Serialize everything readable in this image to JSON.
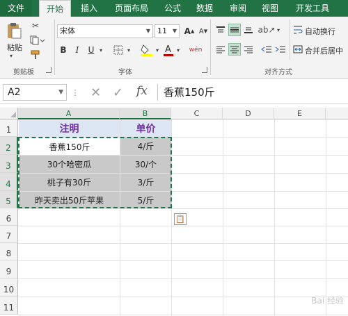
{
  "ribbon": {
    "tabs": [
      {
        "label": "文件",
        "name": "tab-file"
      },
      {
        "label": "开始",
        "name": "tab-home"
      },
      {
        "label": "插入",
        "name": "tab-insert"
      },
      {
        "label": "页面布局",
        "name": "tab-page-layout"
      },
      {
        "label": "公式",
        "name": "tab-formulas"
      },
      {
        "label": "数据",
        "name": "tab-data"
      },
      {
        "label": "审阅",
        "name": "tab-review"
      },
      {
        "label": "视图",
        "name": "tab-view"
      },
      {
        "label": "开发工具",
        "name": "tab-developer"
      }
    ],
    "active_tab": "开始",
    "clipboard": {
      "paste_label": "粘贴",
      "group_label": "剪贴板"
    },
    "font": {
      "font_name": "宋体",
      "font_size": "11",
      "group_label": "字体"
    },
    "alignment": {
      "wrap_text_label": "自动换行",
      "merge_center_label": "合并后居中",
      "group_label": "对齐方式"
    }
  },
  "formula_bar": {
    "name_box": "A2",
    "formula": "香蕉150斤",
    "fx_label": "fx"
  },
  "grid": {
    "columns": [
      "A",
      "B",
      "C",
      "D",
      "E"
    ],
    "rows": [
      "1",
      "2",
      "3",
      "4",
      "5",
      "6",
      "7",
      "8",
      "9",
      "10",
      "11"
    ],
    "cells": {
      "A1": "注明",
      "B1": "单价",
      "A2": "香蕉150斤",
      "B2": "4/斤",
      "A3": "30个哈密瓜",
      "B3": "30/个",
      "A4": "桃子有30斤",
      "B4": "3/斤",
      "A5": "昨天卖出50斤苹果",
      "B5": "5/斤"
    }
  },
  "colors": {
    "accent": "#217346",
    "header_fill": "#dde6f3",
    "header_text": "#7030a0",
    "range_fill": "#c9c9c9"
  },
  "watermark": "Bai 经验"
}
